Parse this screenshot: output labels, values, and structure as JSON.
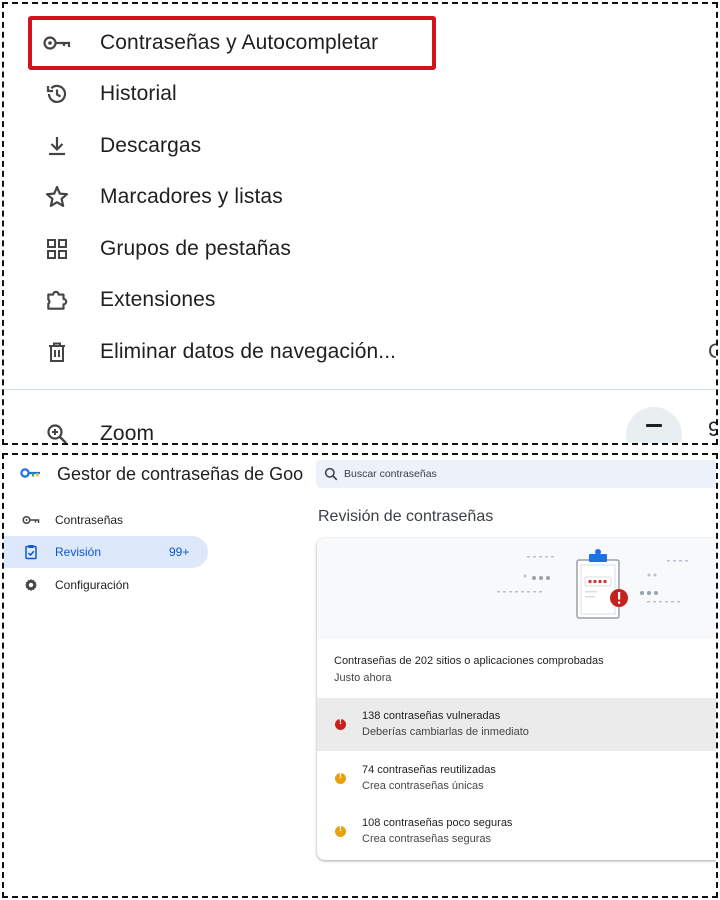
{
  "menu": {
    "items": [
      {
        "label": "Contraseñas y Autocompletar",
        "icon": "key-icon"
      },
      {
        "label": "Historial",
        "icon": "history-icon"
      },
      {
        "label": "Descargas",
        "icon": "download-icon"
      },
      {
        "label": "Marcadores y listas",
        "icon": "star-icon"
      },
      {
        "label": "Grupos de pestañas",
        "icon": "tab-groups-icon"
      },
      {
        "label": "Extensiones",
        "icon": "puzzle-icon"
      },
      {
        "label": "Eliminar datos de navegación...",
        "icon": "trash-icon"
      }
    ],
    "delete_shortcut_fragment": "C",
    "zoom": {
      "label": "Zoom",
      "value_fragment": "9"
    },
    "highlight_color": "#d3121b"
  },
  "manager": {
    "title": "Gestor de contraseñas de Goo",
    "search": {
      "placeholder": "Buscar contraseñas"
    },
    "nav": [
      {
        "label": "Contraseñas",
        "icon": "key-icon"
      },
      {
        "label": "Revisión",
        "icon": "checkup-icon",
        "count": "99+"
      },
      {
        "label": "Configuración",
        "icon": "gear-icon"
      }
    ],
    "section_title": "Revisión de contraseñas",
    "summary": {
      "line1": "Contraseñas de 202 sitios o aplicaciones comprobadas",
      "line2": "Justo ahora"
    },
    "results": [
      {
        "title": "138 contraseñas vulneradas",
        "subtitle": "Deberías cambiarlas de inmediato",
        "severity": "red"
      },
      {
        "title": "74 contraseñas reutilizadas",
        "subtitle": "Crea contraseñas únicas",
        "severity": "yellow"
      },
      {
        "title": "108 contraseñas poco seguras",
        "subtitle": "Crea contraseñas seguras",
        "severity": "yellow"
      }
    ],
    "colors": {
      "accent": "#0b57d0",
      "red": "#c5221f",
      "yellow": "#e8a210",
      "active_bg": "#dde8fb"
    }
  }
}
